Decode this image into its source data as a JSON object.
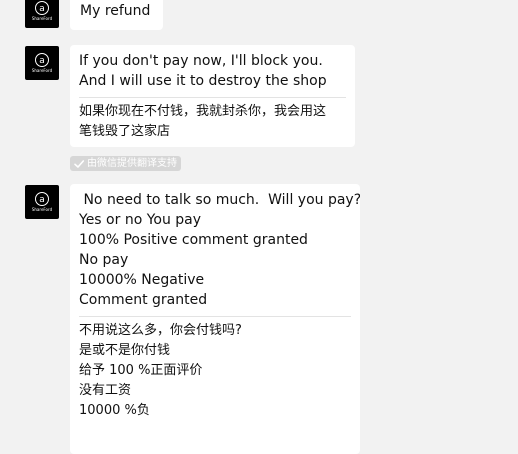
{
  "messages": [
    {
      "avatar": {
        "glyph": "a",
        "caption": "ShareFord"
      },
      "en_lines": [
        "My refund"
      ]
    },
    {
      "avatar": {
        "glyph": "a",
        "caption": "ShareFord"
      },
      "en_lines": [
        "If you don't pay now, I'll block you.",
        "And I will use it to destroy the shop"
      ],
      "zh_lines": [
        "如果你现在不付钱，我就封杀你，我会用这",
        "笔钱毁了这家店"
      ]
    },
    {
      "avatar": {
        "glyph": "a",
        "caption": "ShareFord"
      },
      "en_lines": [
        " No need to talk so much.  Will you pay?",
        "Yes or no You pay",
        "100% Positive comment granted",
        "",
        "No pay",
        "10000% Negative",
        "Comment granted"
      ],
      "zh_lines": [
        "不用说这么多，你会付钱吗?",
        "是或不是你付钱",
        "给予 100 %正面评价",
        "没有工资",
        "10000 %负"
      ]
    }
  ],
  "translation_badge": {
    "icon": "check-icon",
    "label": "由微信提供翻译支持"
  },
  "colors": {
    "background": "#f2f2f2",
    "bubble": "#ffffff",
    "avatar": "#000000",
    "badge": "#d6d6d6"
  }
}
